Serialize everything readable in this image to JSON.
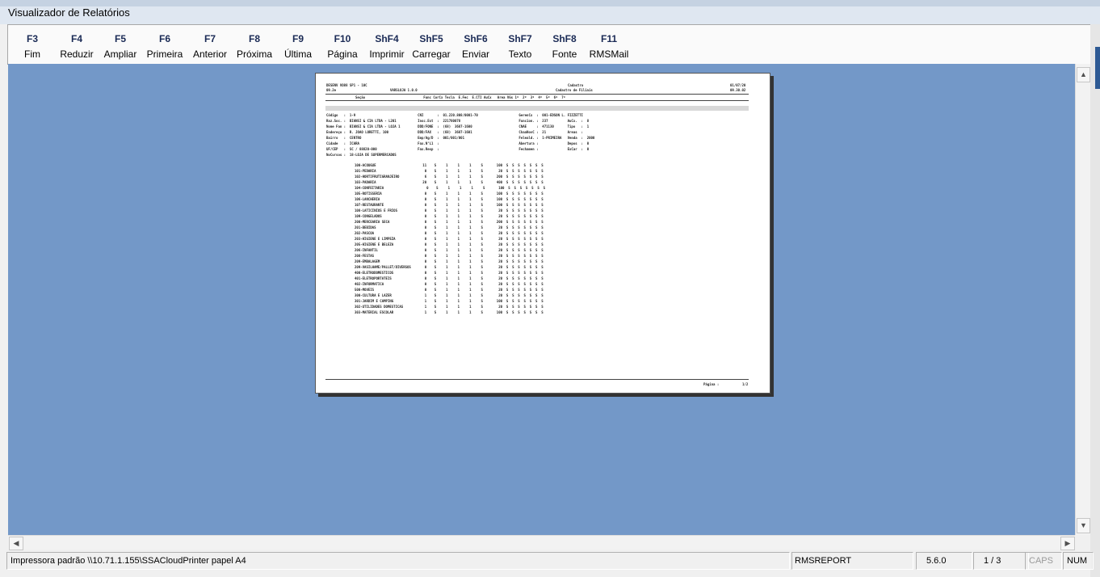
{
  "window": {
    "title": "Visualizador de Relatórios"
  },
  "toolbar": [
    {
      "key": "F3",
      "label": "Fim"
    },
    {
      "key": "F4",
      "label": "Reduzir"
    },
    {
      "key": "F5",
      "label": "Ampliar"
    },
    {
      "key": "F6",
      "label": "Primeira"
    },
    {
      "key": "F7",
      "label": "Anterior"
    },
    {
      "key": "F8",
      "label": "Próxima"
    },
    {
      "key": "F9",
      "label": "Última"
    },
    {
      "key": "F10",
      "label": "Página"
    },
    {
      "key": "ShF4",
      "label": "Imprimir"
    },
    {
      "key": "ShF5",
      "label": "Carregar"
    },
    {
      "key": "ShF6",
      "label": "Enviar"
    },
    {
      "key": "ShF7",
      "label": "Texto"
    },
    {
      "key": "ShF8",
      "label": "Fonte"
    },
    {
      "key": "F11",
      "label": "RMSMail"
    }
  ],
  "report": {
    "header_left_1": "DESENV VO88 SP1 - 10C",
    "header_left_2": "09.2e",
    "header_mid_left": "VARSLOJA 1.0.0",
    "header_center_1": "Cadastro",
    "header_center_2": "Cadastro de Filiais",
    "header_date": "01/07/20",
    "header_time": "09.30.02",
    "columns_line": "Seção                              Func CorCx Tecla  E.Fec  E.CTI AuCx   Area VGs 1º  2º  3º  4º  5º  6º  7º",
    "fields": [
      "Código   :  1-9                                CNI       :  01.220.808/0001-70                     GerenCx  :  001-EDSON L. FIZZETTI",
      "Raz.Soc. :  BIANSI & CIA LTDA - L201           Insc.Est  :  221780078                              Funcion. :  237          AuCx.  :  8",
      "Nome Fan :  BIANSI & CIA LTDA - LOJA 1         DDD/FONE  :  (68)  3687-1600                        CNAE     :  471130       Tipo   :  1",
      "Endereço :  R. JOAO LORETTI, 100               DDD/FAX   :  (68)  3687-1601                        ChaaNovC :  21           Areas  :",
      "Bairro   :  CENTRO                             Emp/Ag/D  :  001/001/001                            Feleald. :  1-PRIMEIRA   Venda  :  2000",
      "Cidade   :  ICARA                              Fax.N°L1  :                                         Abertura :               Depos  :  0",
      "UF/CEP   :  SC / 88820-000                     Fax.Resp  :                                         Fechamen :               ExCar  :  0",
      "NoCursos :  18-LOJA DE SUPERMERCADOS"
    ],
    "sections": [
      "100-ACOUGUE                        11    S     1     1     1     S       100  S  S  S  S  S  S  S",
      "101-PEDARIA                         0    S     1     1     1     S        20  S  S  S  S  S  S  S",
      "102-HORTIFRUTIGRANJEIRO             6    S     1     1     1     S       200  S  S  S  S  S  S  S",
      "103-PADARIA                        20    S     1     1     1     S       400  S  S  S  S  S  S  S",
      "104-CONFEITARIA                      0    S     1     1     1     S       100  S  S  S  S  S  S  S",
      "105-ROTISSERIA                      0    S     1     1     1     S       100  S  S  S  S  S  S  S",
      "106-LANCHERIA                       0    S     1     1     1     S       100  S  S  S  S  S  S  S",
      "107-RESTAURANTE                     0    S     1     1     1     S       100  S  S  S  S  S  S  S",
      "108-LATICINIOS E FRIOS              0    S     1     1     1     S        20  S  S  S  S  S  S  S",
      "109-CONGELADOS                      0    S     1     1     1     S        20  S  S  S  S  S  S  S",
      "200-MERCEARIA SECA                  0    S     1     1     1     S       200  S  S  S  S  S  S  S",
      "201-BEBIDAS                         0    S     1     1     1     S        20  S  S  S  S  S  S  S",
      "202-PASCOA                          0    S     1     1     1     S        20  S  S  S  S  S  S  S",
      "203-HIGIENE E LIMPEZA               0    S     1     1     1     S        20  S  S  S  S  S  S  S",
      "205-HIGIENE E BELEZA                0    S     1     1     1     S        20  S  S  S  S  S  S  S",
      "206-INFANTIL                        0    S     1     1     1     S        20  S  S  S  S  S  S  S",
      "208-FESTAS                          0    S     1     1     1     S        20  S  S  S  S  S  S  S",
      "209-EMBALAGEM                       0    S     1     1     1     S        20  S  S  S  S  S  S  S",
      "209-VASILHAME/PALLET/DIVERSOS       0    S     1     1     1     S        20  S  S  S  S  S  S  S",
      "400-ELETRODOMESTICOS                0    S     1     1     1     S        20  S  S  S  S  S  S  S",
      "401-ELETROPORTATEIS                 0    S     1     1     1     S        20  S  S  S  S  S  S  S",
      "402-INFORMATICA                     0    S     1     1     1     S        20  S  S  S  S  S  S  S",
      "500-MOVEIS                          0    S     1     1     1     S        20  S  S  S  S  S  S  S",
      "300-CULTURA E LAZER                 1    S     1     1     1     S        20  S  S  S  S  S  S  S",
      "301-JARDIM E CAMPING                1    S     1     1     1     S       100  S  S  S  S  S  S  S",
      "302-UTILIDADES DOMESTICAS           1    S     1     1     1     S        20  S  S  S  S  S  S  S",
      "303-MATERIAL ESCOLAR                1    S     1     1     1     S       100  S  S  S  S  S  S  S"
    ],
    "footer_label": "Página :",
    "footer_page": "1/2"
  },
  "status": {
    "printer": "Impressora padrão \\\\10.71.1.155\\SSACloudPrinter papel A4",
    "app": "RMSREPORT",
    "version": "5.6.0",
    "pages": "1 / 3",
    "caps": "CAPS",
    "num": "NUM"
  }
}
